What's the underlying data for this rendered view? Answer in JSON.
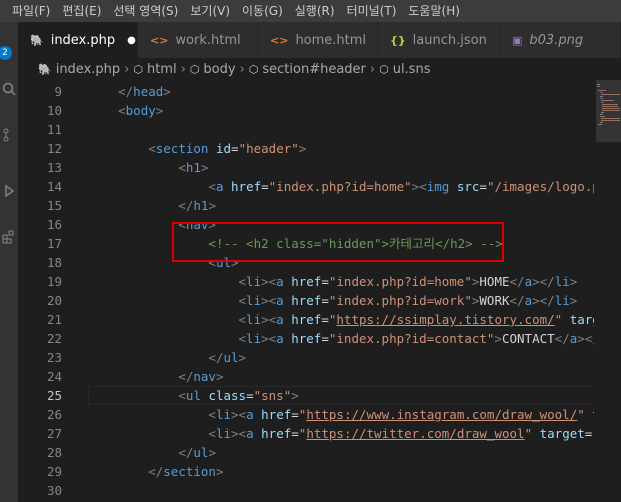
{
  "menu": [
    "파일(F)",
    "편집(E)",
    "선택 영역(S)",
    "보기(V)",
    "이동(G)",
    "실행(R)",
    "터미널(T)",
    "도움말(H)"
  ],
  "activity": {
    "badge": "2"
  },
  "tabs": [
    {
      "label": "index.php",
      "icon": "elephant-icon",
      "active": true,
      "dirty_marker": "●"
    },
    {
      "label": "work.html",
      "icon": "html-brackets-icon",
      "active": false
    },
    {
      "label": "home.html",
      "icon": "html-brackets-icon",
      "active": false
    },
    {
      "label": "launch.json",
      "icon": "json-braces-icon",
      "active": false
    },
    {
      "label": "b03.png",
      "icon": "image-icon",
      "active": false,
      "italic": true
    }
  ],
  "breadcrumb": [
    "index.php",
    "html",
    "body",
    "section#header",
    "ul.sns"
  ],
  "editor": {
    "current_line": 25,
    "lines": [
      {
        "num": "9",
        "code": "    </head>"
      },
      {
        "num": "10",
        "code": "    <body>"
      },
      {
        "num": "11",
        "code": ""
      },
      {
        "num": "12",
        "code": "        <section id=\"header\">"
      },
      {
        "num": "13",
        "code": "            <h1>"
      },
      {
        "num": "14",
        "code": "                <a href=\"index.php?id=home\"><img src=\"/images/logo.png"
      },
      {
        "num": "15",
        "code": "            </h1>"
      },
      {
        "num": "16",
        "code": "            <nav>"
      },
      {
        "num": "17",
        "code": "                <!-- <h2 class=\"hidden\">카테고리</h2> -->"
      },
      {
        "num": "18",
        "code": "                <ul>"
      },
      {
        "num": "19",
        "code": "                    <li><a href=\"index.php?id=home\">HOME</a></li>"
      },
      {
        "num": "20",
        "code": "                    <li><a href=\"index.php?id=work\">WORK</a></li>"
      },
      {
        "num": "21",
        "code": "                    <li><a href=\"https://ssimplay.tistory.com/\" target"
      },
      {
        "num": "22",
        "code": "                    <li><a href=\"index.php?id=contact\">CONTACT</a></li"
      },
      {
        "num": "23",
        "code": "                </ul>"
      },
      {
        "num": "24",
        "code": "            </nav>"
      },
      {
        "num": "25",
        "code": "            <ul class=\"sns\">"
      },
      {
        "num": "26",
        "code": "                <li><a href=\"https://www.instagram.com/draw_wool/\" tar"
      },
      {
        "num": "27",
        "code": "                <li><a href=\"https://twitter.com/draw_wool\" target=\"_b"
      },
      {
        "num": "28",
        "code": "            </ul>"
      },
      {
        "num": "29",
        "code": "        </section>"
      },
      {
        "num": "30",
        "code": ""
      }
    ]
  }
}
